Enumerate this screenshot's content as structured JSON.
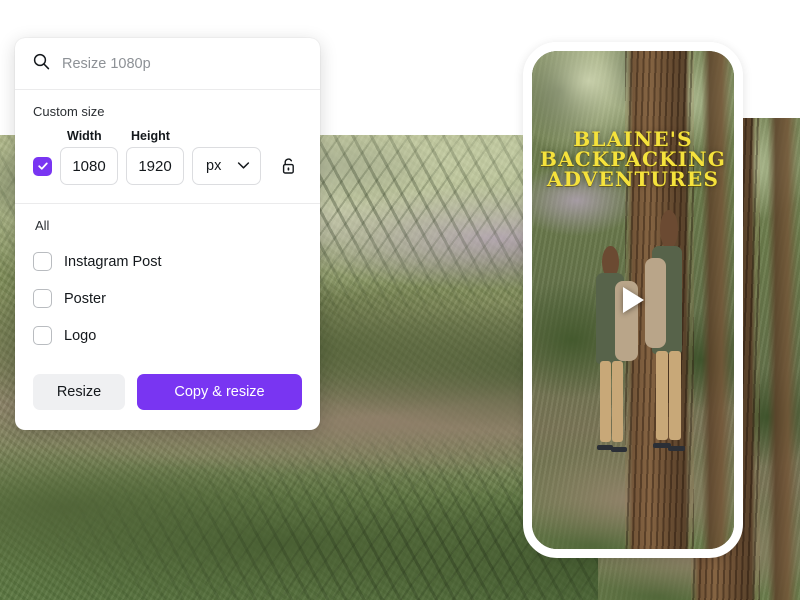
{
  "panel": {
    "search": {
      "icon": "search-icon",
      "value": "",
      "placeholder": "Resize 1080p"
    },
    "custom_size": {
      "section_label": "Custom size",
      "width_label": "Width",
      "height_label": "Height",
      "width_value": "1080",
      "height_value": "1920",
      "unit_value": "px",
      "unit_caret_icon": "chevron-down-icon",
      "lock_icon": "unlock-icon",
      "link_checkbox_checked": true
    },
    "presets": {
      "group_label": "All",
      "items": [
        {
          "label": "Instagram Post",
          "checked": false
        },
        {
          "label": "Poster",
          "checked": false
        },
        {
          "label": "Logo",
          "checked": false
        }
      ]
    },
    "footer": {
      "resize_label": "Resize",
      "copy_resize_label": "Copy & resize"
    }
  },
  "preview": {
    "play_icon": "play-icon",
    "title_line_1": "BLAINE'S",
    "title_line_2": "BACKPACKING",
    "title_line_3": "ADVENTURES"
  },
  "colors": {
    "accent_purple": "#7935f2",
    "button_secondary": "#eff0f2",
    "title_yellow": "#f5e23c",
    "panel_background": "#ffffff",
    "border_grey": "#dcdde0"
  }
}
